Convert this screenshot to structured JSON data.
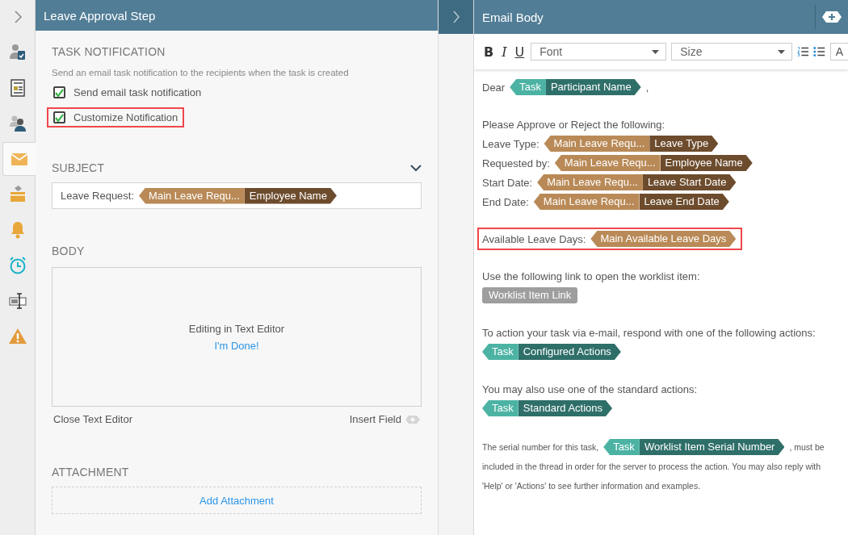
{
  "rail": {
    "items": [
      {
        "selected": false
      },
      {
        "selected": false
      },
      {
        "selected": false
      },
      {
        "selected": false
      },
      {
        "selected": true
      },
      {
        "selected": false
      },
      {
        "selected": false
      },
      {
        "selected": false
      },
      {
        "selected": false
      },
      {
        "selected": false
      }
    ]
  },
  "step_panel": {
    "title": "Leave Approval Step",
    "task_notification": {
      "heading": "TASK NOTIFICATION",
      "description": "Send an email task notification to the recipients when the task is created",
      "options": [
        {
          "label": "Send email task notification",
          "checked": true,
          "highlighted": false
        },
        {
          "label": "Customize Notification",
          "checked": true,
          "highlighted": true
        }
      ]
    },
    "subject": {
      "heading": "SUBJECT",
      "expanded": true,
      "segments": [
        {
          "text": "Leave Request:"
        },
        {
          "token": {
            "kind": "data",
            "source": "Main Leave Requ...",
            "field": "Employee Name"
          }
        }
      ]
    },
    "body": {
      "heading": "BODY",
      "editor_message": "Editing in Text Editor",
      "done_link": "I'm Done!",
      "close_link": "Close Text Editor",
      "insert_field": "Insert Field"
    },
    "attachment": {
      "heading": "ATTACHMENT",
      "add_button": "Add Attachment"
    }
  },
  "email_body": {
    "title": "Email Body",
    "toolbar": {
      "bold": "B",
      "italic": "I",
      "underline": "U",
      "font": "Font",
      "size": "Size",
      "cut_button": "A"
    },
    "blocks": [
      {
        "kind": "paragraph",
        "highlighted": false,
        "lines": [
          [
            {
              "text": "Dear"
            },
            {
              "token": {
                "kind": "task",
                "source": "Task",
                "field": "Participant Name"
              }
            },
            {
              "text": ","
            }
          ]
        ]
      },
      {
        "kind": "paragraph",
        "highlighted": false,
        "lines": [
          [
            {
              "text": "Please Approve or Reject the following:"
            }
          ],
          [
            {
              "text": "Leave Type:"
            },
            {
              "token": {
                "kind": "data",
                "source": "Main Leave Requ...",
                "field": "Leave Type"
              }
            }
          ],
          [
            {
              "text": "Requested by:"
            },
            {
              "token": {
                "kind": "data",
                "source": "Main Leave Requ...",
                "field": "Employee Name"
              }
            }
          ],
          [
            {
              "text": "Start Date:"
            },
            {
              "token": {
                "kind": "data",
                "source": "Main Leave Requ...",
                "field": "Leave Start Date"
              }
            }
          ],
          [
            {
              "text": "End Date:"
            },
            {
              "token": {
                "kind": "data",
                "source": "Main Leave Requ...",
                "field": "Leave End Date"
              }
            }
          ]
        ]
      },
      {
        "kind": "paragraph",
        "highlighted": true,
        "lines": [
          [
            {
              "text": "Available Leave Days:"
            },
            {
              "token": {
                "kind": "data",
                "source": "Main Available Leave Days"
              }
            }
          ]
        ]
      },
      {
        "kind": "paragraph",
        "highlighted": false,
        "lines": [
          [
            {
              "text": "Use the following link to open the worklist item:"
            }
          ],
          [
            {
              "token": {
                "kind": "link",
                "field": "Worklist Item Link"
              }
            }
          ]
        ]
      },
      {
        "kind": "paragraph",
        "highlighted": false,
        "lines": [
          [
            {
              "text": "To action your task via e-mail, respond with one of the following actions:"
            }
          ],
          [
            {
              "token": {
                "kind": "task",
                "source": "Task",
                "field": "Configured Actions"
              }
            }
          ]
        ]
      },
      {
        "kind": "paragraph",
        "highlighted": false,
        "lines": [
          [
            {
              "text": "You may also use one of the standard actions:"
            }
          ],
          [
            {
              "token": {
                "kind": "task",
                "source": "Task",
                "field": "Standard Actions"
              }
            }
          ]
        ]
      },
      {
        "kind": "note",
        "highlighted": false,
        "lines": [
          [
            {
              "text": "The serial number for this task,"
            },
            {
              "token": {
                "kind": "task",
                "source": "Task",
                "field": "Worklist Item Serial Number"
              }
            },
            {
              "text": ", must be"
            }
          ],
          [
            {
              "text": "included in the thread in order for the server to process the action. You may also reply with"
            }
          ],
          [
            {
              "text": "'Help' or 'Actions' to see further information and examples."
            }
          ]
        ]
      }
    ]
  }
}
